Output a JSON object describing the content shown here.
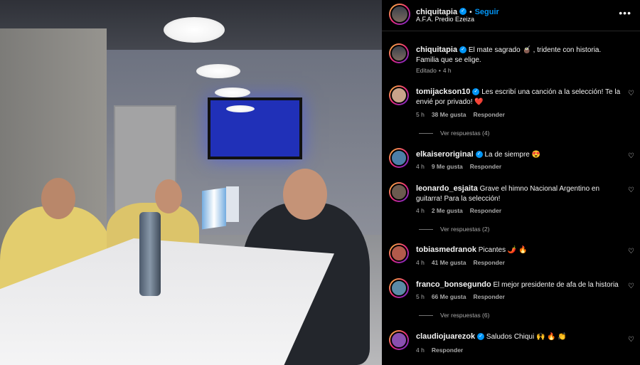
{
  "post": {
    "username": "chiquitapia",
    "verified_mark": "✓",
    "separator": "•",
    "follow_label": "Seguir",
    "location": "A.F.A. Predio Ezeiza",
    "more_icon": "more-horizontal-icon",
    "more_label": "•••"
  },
  "caption": {
    "username": "chiquitapia",
    "text": "El mate sagrado 🧉 , tridente con historia. Familia que se elige.",
    "edited": "Editado",
    "time": "4 h"
  },
  "comments": [
    {
      "username": "tomijackson10",
      "text": "Les escribí una canción a la selección! Te la envié por privado! ❤️",
      "time": "5 h",
      "likes": "38 Me gusta",
      "reply_label": "Responder",
      "view_replies": "Ver respuestas (4)",
      "avatar_color": "#c9a38a"
    },
    {
      "username": "elkaiseroriginal",
      "text": "La de siempre 😍",
      "time": "4 h",
      "likes": "9 Me gusta",
      "reply_label": "Responder",
      "view_replies": "",
      "avatar_color": "#4c7ea8"
    },
    {
      "username": "leonardo_esjaita",
      "text": "Grave el himno Nacional Argentino en guitarra! Para la selección!",
      "time": "4 h",
      "likes": "2 Me gusta",
      "reply_label": "Responder",
      "view_replies": "Ver respuestas (2)",
      "avatar_color": "#6b5a4f"
    },
    {
      "username": "tobiasmedranok",
      "text": "Picantes 🌶️ 🔥",
      "time": "4 h",
      "likes": "41 Me gusta",
      "reply_label": "Responder",
      "view_replies": "",
      "avatar_color": "#b25a4b"
    },
    {
      "username": "franco_bonsegundo",
      "text": "El mejor presidente de afa de la historia",
      "time": "5 h",
      "likes": "66 Me gusta",
      "reply_label": "Responder",
      "view_replies": "Ver respuestas (6)",
      "avatar_color": "#5b8aa6"
    },
    {
      "username": "claudiojuarezok",
      "text": "Saludos Chiqui 🙌 🔥 👏",
      "time": "4 h",
      "likes": "",
      "reply_label": "Responder",
      "view_replies": "",
      "avatar_color": "#8a4fb0"
    }
  ],
  "icons": {
    "heart": "♡"
  },
  "colors": {
    "accent": "#0095f6",
    "background": "#000000",
    "secondary_text": "#a8a8a8"
  }
}
